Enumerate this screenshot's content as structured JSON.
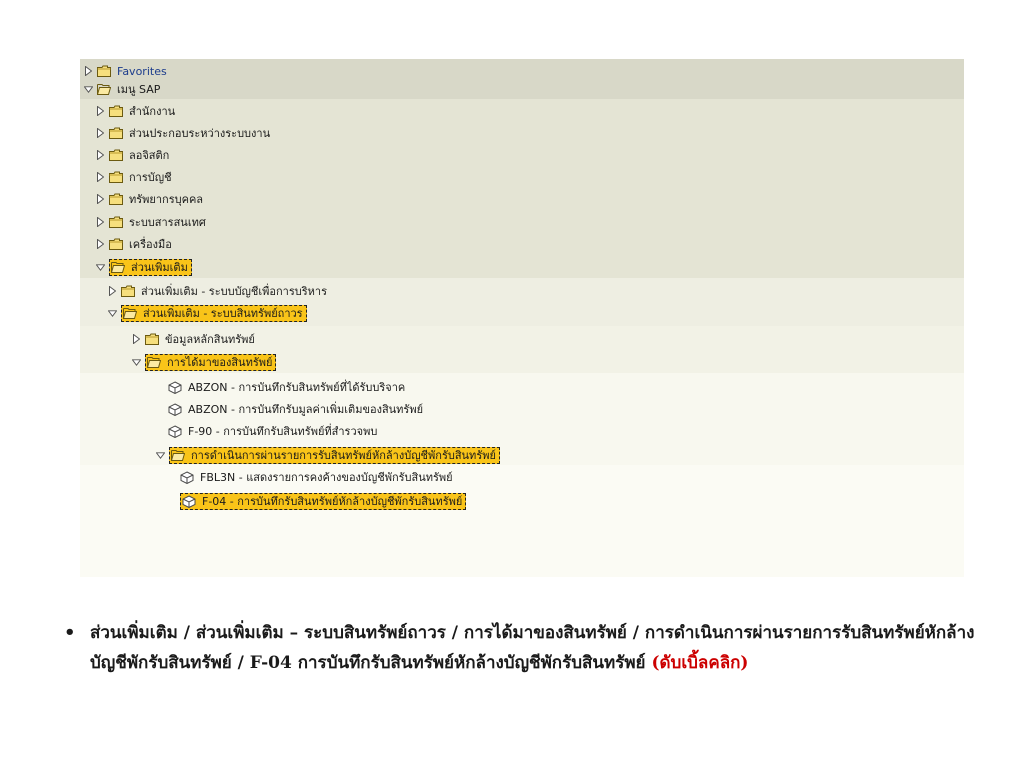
{
  "tree": {
    "nodes": [
      {
        "label": "Favorites",
        "icon": "folder-icon",
        "state": "collapsed",
        "highlight": false
      },
      {
        "label": "เมนู SAP",
        "icon": "folder-open-icon",
        "state": "expanded",
        "highlight": false
      },
      {
        "label": "สำนักงาน",
        "icon": "folder-icon",
        "state": "collapsed",
        "highlight": false
      },
      {
        "label": "ส่วนประกอบระหว่างระบบงาน",
        "icon": "folder-icon",
        "state": "collapsed",
        "highlight": false
      },
      {
        "label": "ลอจิสติก",
        "icon": "folder-icon",
        "state": "collapsed",
        "highlight": false
      },
      {
        "label": "การบัญชี",
        "icon": "folder-icon",
        "state": "collapsed",
        "highlight": false
      },
      {
        "label": "ทรัพยากรบุคคล",
        "icon": "folder-icon",
        "state": "collapsed",
        "highlight": false
      },
      {
        "label": "ระบบสารสนเทศ",
        "icon": "folder-icon",
        "state": "collapsed",
        "highlight": false
      },
      {
        "label": "เครื่องมือ",
        "icon": "folder-icon",
        "state": "collapsed",
        "highlight": false
      },
      {
        "label": "ส่วนเพิ่มเติม",
        "icon": "folder-open-icon",
        "state": "expanded",
        "highlight": true
      },
      {
        "label": "ส่วนเพิ่มเติม - ระบบบัญชีเพื่อการบริหาร",
        "icon": "folder-icon",
        "state": "collapsed",
        "highlight": false
      },
      {
        "label": "ส่วนเพิ่มเติม - ระบบสินทรัพย์ถาวร",
        "icon": "folder-open-icon",
        "state": "expanded",
        "highlight": true
      },
      {
        "label": "ข้อมูลหลักสินทรัพย์",
        "icon": "folder-icon",
        "state": "collapsed",
        "highlight": false
      },
      {
        "label": "การได้มาของสินทรัพย์",
        "icon": "folder-open-icon",
        "state": "expanded",
        "highlight": true
      },
      {
        "label": "ABZON - การบันทึกรับสินทรัพย์ที่ได้รับบริจาค",
        "icon": "transaction-cube-icon",
        "state": "leaf",
        "highlight": false
      },
      {
        "label": "ABZON - การบันทึกรับมูลค่าเพิ่มเติมของสินทรัพย์",
        "icon": "transaction-cube-icon",
        "state": "leaf",
        "highlight": false
      },
      {
        "label": "F-90 - การบันทึกรับสินทรัพย์ที่สำรวจพบ",
        "icon": "transaction-cube-icon",
        "state": "leaf",
        "highlight": false
      },
      {
        "label": "การดำเนินการผ่านรายการรับสินทรัพย์หักล้างบัญชีพักรับสินทรัพย์",
        "icon": "folder-open-icon",
        "state": "expanded",
        "highlight": true
      },
      {
        "label": "FBL3N - แสดงรายการคงค้างของบัญชีพักรับสินทรัพย์",
        "icon": "transaction-cube-icon",
        "state": "leaf",
        "highlight": false
      },
      {
        "label": "F-04 - การบันทึกรับสินทรัพย์หักล้างบัญชีพักรับสินทรัพย์",
        "icon": "transaction-cube-icon",
        "state": "leaf",
        "highlight": true
      }
    ]
  },
  "caption": {
    "bullet": "•",
    "text": "ส่วนเพิ่มเติม / ส่วนเพิ่มเติม – ระบบสินทรัพย์ถาวร / การได้มาของสินทรัพย์ / การดำเนินการผ่านรายการรับสินทรัพย์หักล้างบัญชีพักรับสินทรัพย์ / F-04 การบันทึกรับสินทรัพย์หักล้างบัญชีพักรับสินทรัพย์ ",
    "hint": "(ดับเบิ้ลคลิก)"
  },
  "colors": {
    "tree_background": "#d8d8c8",
    "band_level_2": "#e4e4d4",
    "band_level_3": "#eeeee2",
    "band_level_4": "#f2f2e6",
    "band_level_5": "#f8f8ef",
    "highlight": "#f9c419",
    "folder_yellow": "#f6df7d",
    "hint_red": "#cc0000"
  }
}
